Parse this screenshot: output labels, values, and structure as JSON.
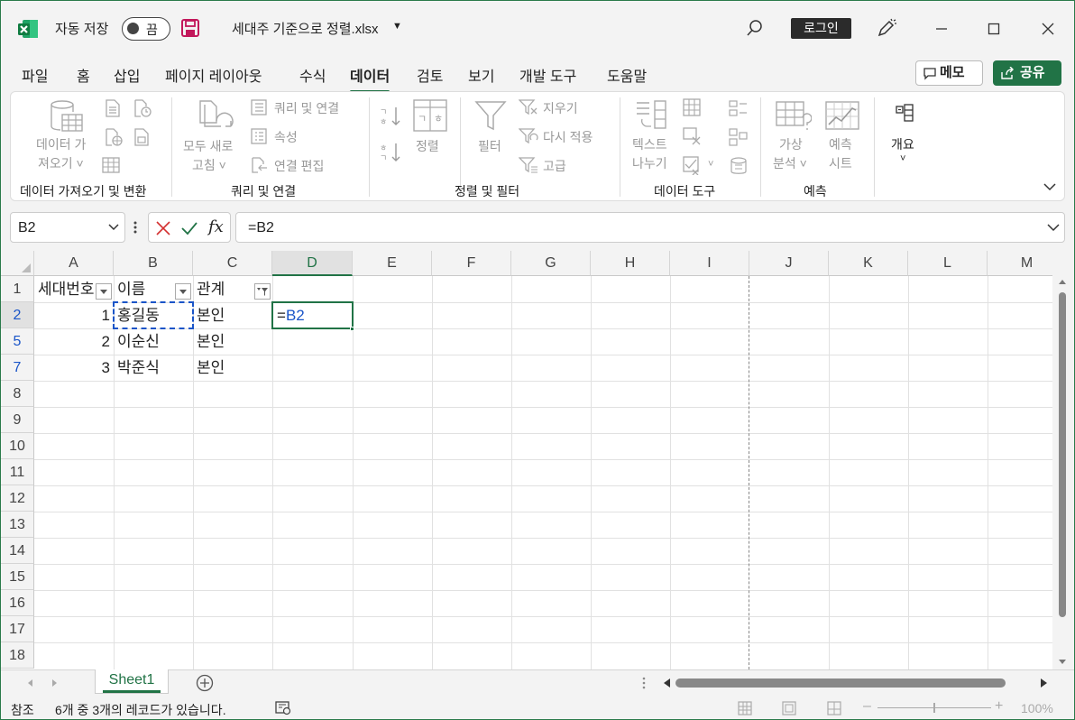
{
  "titlebar": {
    "autosave_label": "자동 저장",
    "autosave_state": "끔",
    "filename": "세대주 기준으로 정렬.xlsx",
    "login_label": "로그인"
  },
  "menu": {
    "tabs": [
      "파일",
      "홈",
      "삽입",
      "페이지 레이아웃",
      "수식",
      "데이터",
      "검토",
      "보기",
      "개발 도구",
      "도움말"
    ],
    "active_tab": "데이터",
    "memo_label": "메모",
    "share_label": "공유"
  },
  "ribbon": {
    "get_data_1": "데이터 가",
    "get_data_2": "져오기 ˅",
    "refresh_1": "모두 새로",
    "refresh_2": "고침 ˅",
    "queries_connections": "쿼리 및 연결",
    "properties": "속성",
    "edit_links": "연결 편집",
    "sort": "정렬",
    "filter": "필터",
    "clear": "지우기",
    "reapply": "다시 적용",
    "advanced": "고급",
    "text_to_columns_1": "텍스트",
    "text_to_columns_2": "나누기",
    "whatif_1": "가상",
    "whatif_2": "분석 ˅",
    "forecast_1": "예측",
    "forecast_2": "시트",
    "outline": "개요",
    "groups": {
      "get_transform": "데이터 가져오기 및 변환",
      "queries": "쿼리 및 연결",
      "sort_filter": "정렬 및 필터",
      "data_tools": "데이터 도구",
      "forecast": "예측"
    }
  },
  "formula_bar": {
    "name_box": "B2",
    "formula": "=B2"
  },
  "sheet": {
    "columns": [
      "A",
      "B",
      "C",
      "D",
      "E",
      "F",
      "G",
      "H",
      "I",
      "J",
      "K",
      "L",
      "M"
    ],
    "selected_column": "D",
    "rows": [
      "1",
      "2",
      "5",
      "7",
      "8",
      "9",
      "10",
      "11",
      "12",
      "13",
      "14",
      "15",
      "16",
      "17",
      "18"
    ],
    "header": [
      "세대번호",
      "이름",
      "관계"
    ],
    "data": [
      {
        "num": "1",
        "name": "홍길동",
        "rel": "본인"
      },
      {
        "num": "2",
        "name": "이순신",
        "rel": "본인"
      },
      {
        "num": "3",
        "name": "박준식",
        "rel": "본인"
      }
    ],
    "editing_cell_prefix": "=",
    "editing_cell_ref": "B2"
  },
  "sheet_tabs": {
    "active": "Sheet1"
  },
  "status": {
    "mode": "참조",
    "record_info": "6개 중 3개의 레코드가 있습니다.",
    "zoom": "100%"
  },
  "colors": {
    "accent": "#217346",
    "ref_blue": "#1a55c8"
  }
}
